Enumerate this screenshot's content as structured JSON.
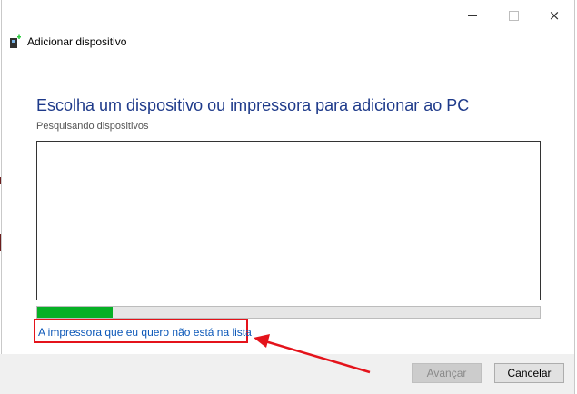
{
  "window": {
    "title": "Adicionar dispositivo",
    "controls": {
      "minimize": "minimize",
      "maximize": "maximize",
      "close": "×"
    }
  },
  "main": {
    "heading": "Escolha um dispositivo ou impressora para adicionar ao PC",
    "status": "Pesquisando dispositivos",
    "device_list": [],
    "progress": 0.15,
    "printer_link": "A impressora que eu quero não está na lista"
  },
  "footer": {
    "next_label": "Avançar",
    "next_enabled": false,
    "cancel_label": "Cancelar"
  },
  "colors": {
    "heading": "#1e3a8a",
    "link": "#0b57b8",
    "progress": "#06b025",
    "annotation": "#e4131b"
  },
  "icons": {
    "app_icon": "printer-add-icon",
    "annotation": "red-arrow-annotation"
  }
}
